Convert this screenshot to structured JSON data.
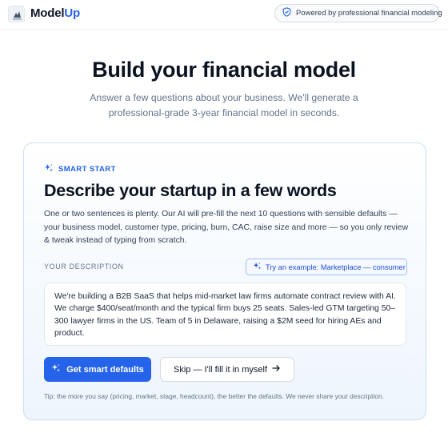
{
  "header": {
    "brand_part1": "Model",
    "brand_part2": "Up",
    "powered_badge": "Powered by professional financial modeling",
    "icons": {
      "logo": "logo-image",
      "badge": "shield-icon"
    }
  },
  "hero": {
    "title": "Build your financial model",
    "subtitle_line1": "Answer a few questions about your business. We'll generate a",
    "subtitle_line2": "professional-grade 3-year financial model in seconds."
  },
  "smart_start": {
    "eyebrow": "SMART START",
    "title": "Describe your startup in a few words",
    "description": "One or two sentences is plenty. Our AI will pre-fill the next 10 questions with sensible defaults — your business model, customer type, pricing, burn, CAC, raise size and more — so you only review & tweak instead of typing from scratch.",
    "field_label": "YOUR DESCRIPTION",
    "example_button": "Try an example: Marketplace — consumer",
    "description_value": "We're building a B2B SaaS that helps mid-market law firms automate contract review with AI. We charge $400/seat/month and the typical firm buys 25 seats. Sales-led GTM targeting 50–300 lawyer firms in the US. Team of 5 in Delaware, raising a $2M seed for hiring AEs and product.",
    "primary_button": "Get smart defaults",
    "secondary_button": "Skip — I'll fill it in myself",
    "tip": "Tip: the more you say (pricing, market, stage, headcount), the better the defaults. We never share your description.",
    "icons": {
      "eyebrow": "sparkles-icon",
      "example": "sparkles-icon",
      "primary": "sparkles-icon",
      "secondary": "arrow-right-icon"
    }
  },
  "colors": {
    "accent": "#2563eb",
    "text": "#0f172a",
    "muted": "#64748b",
    "card_border": "#cfe0f5"
  }
}
